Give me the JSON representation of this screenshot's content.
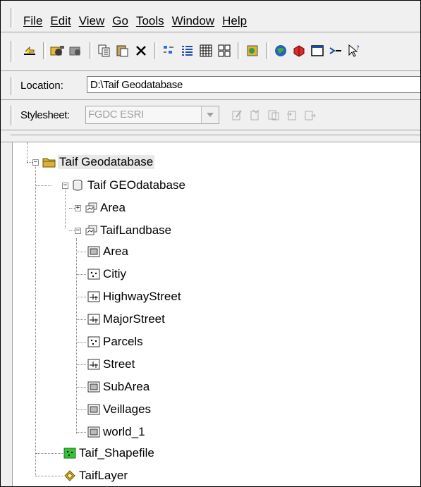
{
  "menu": {
    "items": [
      "File",
      "Edit",
      "View",
      "Go",
      "Tools",
      "Window",
      "Help"
    ]
  },
  "toolbar": {
    "buttons": [
      "up-folder-icon",
      "connect-folder-icon",
      "disconnect-folder-icon",
      "copy-icon",
      "paste-icon",
      "delete-icon",
      "large-icons-icon",
      "list-icon",
      "details-icon",
      "thumbnails-icon",
      "launch-arcmap-icon",
      "arctoolbox-icon",
      "search-icon",
      "toolbox-icon",
      "command-line-icon",
      "arrow-icon",
      "whats-this-icon"
    ]
  },
  "location": {
    "label": "Location:",
    "value": "D:\\Taif Geodatabase"
  },
  "stylesheet": {
    "label": "Stylesheet:",
    "value": "FGDC ESRI"
  },
  "tree": {
    "root": "Taif Geodatabase",
    "geodatabase": "Taif GEOdatabase",
    "datasets": [
      "Area",
      "TaifLandbase"
    ],
    "feature_classes": [
      {
        "name": "Area",
        "type": "polygon"
      },
      {
        "name": "Citiy",
        "type": "point"
      },
      {
        "name": "HighwayStreet",
        "type": "line"
      },
      {
        "name": "MajorStreet",
        "type": "line"
      },
      {
        "name": "Parcels",
        "type": "point"
      },
      {
        "name": "Street",
        "type": "line"
      },
      {
        "name": "SubArea",
        "type": "polygon"
      },
      {
        "name": "Veillages",
        "type": "polygon"
      },
      {
        "name": "world_1",
        "type": "polygon"
      }
    ],
    "shapefile": "Taif_Shapefile",
    "layer": "TaifLayer"
  }
}
